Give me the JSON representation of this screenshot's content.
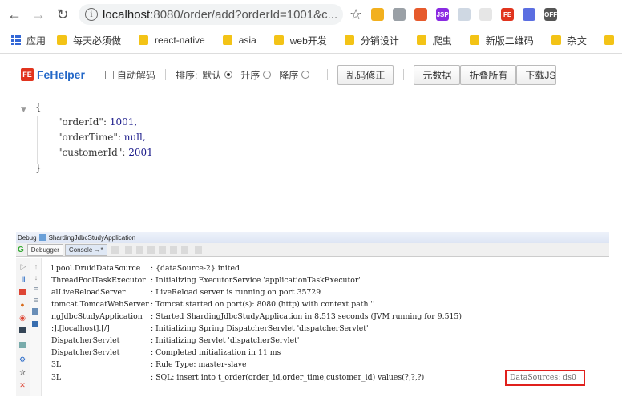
{
  "browser": {
    "nav": {
      "back_icon": "arrow-left-icon",
      "forward_icon": "arrow-right-icon",
      "reload_icon": "reload-icon"
    },
    "url": {
      "host": "localhost",
      "rest": ":8080/order/add?orderId=1001&c..."
    },
    "bookmarks": [
      {
        "label": "应用"
      },
      {
        "label": "每天必须做"
      },
      {
        "label": "react-native"
      },
      {
        "label": "asia"
      },
      {
        "label": "web开发"
      },
      {
        "label": "分销设计"
      },
      {
        "label": "爬虫"
      },
      {
        "label": "新版二维码"
      },
      {
        "label": "杂文"
      }
    ],
    "extensions": [
      {
        "label": "",
        "color": "#f2b01e"
      },
      {
        "label": "",
        "color": "#9aa0a6"
      },
      {
        "label": "",
        "color": "#e65a2c"
      },
      {
        "label": "JSP",
        "color": "#8a2be2"
      },
      {
        "label": "",
        "color": "#cfd8e3"
      },
      {
        "label": "",
        "color": "#e6e6e6"
      },
      {
        "label": "FE",
        "color": "#e1341e"
      },
      {
        "label": "",
        "color": "#5b6ee1"
      },
      {
        "label": "OFF",
        "color": "#555555"
      }
    ]
  },
  "fehelper": {
    "logo": "FeHelper",
    "logo_badge": "FE",
    "auto_decode": "自动解码",
    "sort_label": "排序:",
    "sort_default": "默认",
    "sort_asc": "升序",
    "sort_desc": "降序",
    "fix_button": "乱码修正",
    "raw_button": "元数据",
    "fold_button": "折叠所有",
    "download_button": "下载JSC"
  },
  "json_view": {
    "open": "{",
    "close": "}",
    "rows": [
      {
        "key": "\"orderId\":",
        "value": "1001,"
      },
      {
        "key": "\"orderTime\":",
        "value": "null,"
      },
      {
        "key": "\"customerId\":",
        "value": "2001"
      }
    ]
  },
  "ide": {
    "title_prefix": "Debug",
    "title": "ShardingJdbcStudyApplication",
    "tab_debugger": "Debugger",
    "tab_console": "Console →*",
    "logs": [
      {
        "src": "l.pool.DruidDataSource",
        "msg": ": {dataSource-2} inited"
      },
      {
        "src": "ThreadPoolTaskExecutor",
        "msg": ": Initializing ExecutorService 'applicationTaskExecutor'"
      },
      {
        "src": "alLiveReloadServer",
        "msg": ": LiveReload server is running on port 35729"
      },
      {
        "src": "tomcat.TomcatWebServer",
        "msg": ": Tomcat started on port(s): 8080 (http) with context path ''"
      },
      {
        "src": "ngJdbcStudyApplication",
        "msg": ": Started ShardingJdbcStudyApplication in 8.513 seconds (JVM running for 9.515)"
      },
      {
        "src": ":].[localhost].[/]",
        "msg": ": Initializing Spring DispatcherServlet 'dispatcherServlet'"
      },
      {
        "src": "DispatcherServlet",
        "msg": ": Initializing Servlet 'dispatcherServlet'"
      },
      {
        "src": "DispatcherServlet",
        "msg": ": Completed initialization in 11 ms"
      },
      {
        "src": "3L",
        "msg": ": Rule Type: master-slave"
      },
      {
        "src": "3L",
        "msg": ": SQL: insert into t_order(order_id,order_time,customer_id) values(?,?,?)"
      }
    ],
    "highlight": "DataSources: ds0"
  }
}
